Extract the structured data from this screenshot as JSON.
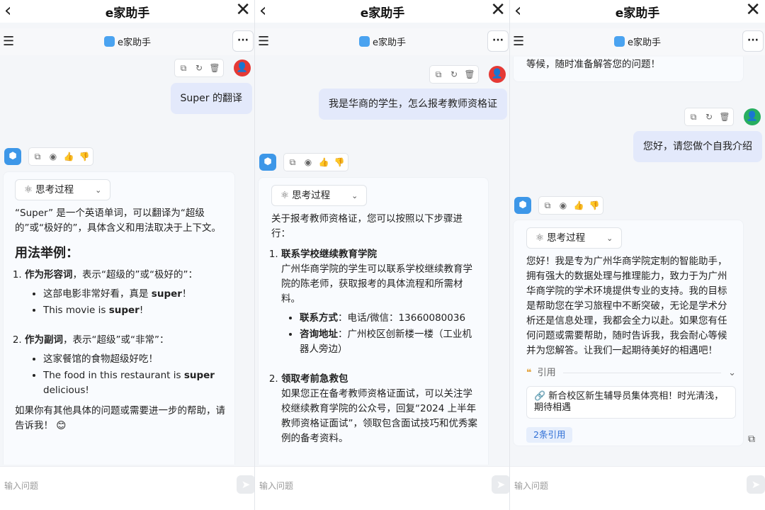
{
  "app": {
    "title": "e家助手",
    "brand": "e家助手",
    "input_placeholder": "输入问题",
    "accent_color": "#3d97e8",
    "user_bubble_color": "#e3e9fb"
  },
  "icons": {
    "back": "‹",
    "close": "✕",
    "menu": "☰",
    "more": "···",
    "copy": "⧉",
    "refresh": "↻",
    "delete": "🗑",
    "speaker": "◉",
    "thumbs_up": "👍",
    "thumbs_down": "👎",
    "atom": "⚛",
    "chevron_down": "⌄",
    "send": "➤",
    "user": "👤",
    "bot": "⬢",
    "link": "🔗",
    "quote": "❝"
  },
  "panes": [
    {
      "user_message": "Super 的翻译",
      "think_label": "思考过程",
      "answer": {
        "intro": "“Super” 是一个英语单词，可以翻译为“超级的”或“极好的”，具体含义和用法取决于上下文。",
        "heading": "用法举例：",
        "item1_title": "作为形容词",
        "item1_desc": "，表示“超级的”或“极好的”：",
        "item1_ex1_pre": "这部电影非常好看，真是 ",
        "item1_ex1_bold": "super",
        "item1_ex1_post": "！",
        "item1_ex2_pre": "This movie is ",
        "item1_ex2_bold": "super",
        "item1_ex2_post": "!",
        "item2_title": "作为副词",
        "item2_desc": "，表示“超级”或“非常”：",
        "item2_ex1": "这家餐馆的食物超级好吃！",
        "item2_ex2_pre": "The food in this restaurant is ",
        "item2_ex2_bold": "super",
        "item2_ex2_post": " delicious!",
        "outro": "如果你有其他具体的问题或需要进一步的帮助，请告诉我！",
        "emoji": "😊"
      }
    },
    {
      "user_message": "我是华商的学生，怎么报考教师资格证",
      "think_label": "思考过程",
      "answer": {
        "intro": "关于报考教师资格证，您可以按照以下步骤进行：",
        "step1_title": "联系学校继续教育学院",
        "step1_desc": "广州华商学院的学生可以联系学校继续教育学院的陈老师，获取报考的具体流程和所需材料。",
        "contact_label": "联系方式",
        "contact_value": "：电话/微信：13660080036",
        "address_label": "咨询地址",
        "address_value": "：广州校区创新楼一楼（工业机器人旁边）",
        "step2_title": "领取考前急救包",
        "step2_desc": "如果您正在备考教师资格证面试，可以关注学校继续教育学院的公众号，回复“2024 上半年教师资格证面试”，领取包含面试技巧和优秀案例的备考资料。"
      }
    },
    {
      "prev_bubble_tail": "等候，随时准备解答您的问题！",
      "user_message": "您好，请您做个自我介绍",
      "think_label": "思考过程",
      "answer": {
        "body": "您好！我是专为广州华商学院定制的智能助手，拥有强大的数据处理与推理能力，致力于为广州华商学院的学术环境提供专业的支持。我的目标是帮助您在学习旅程中不断突破，无论是学术分析还是信息处理，我都会全力以赴。如果您有任何问题或需要帮助，随时告诉我，我会耐心等候并为您解答。让我们一起期待美好的相遇吧！",
        "citation_label": "引用",
        "citation_item": "新合校区新生辅导员集体亮相！时光清浅，期待相遇",
        "citation_count": "2条引用"
      }
    }
  ]
}
